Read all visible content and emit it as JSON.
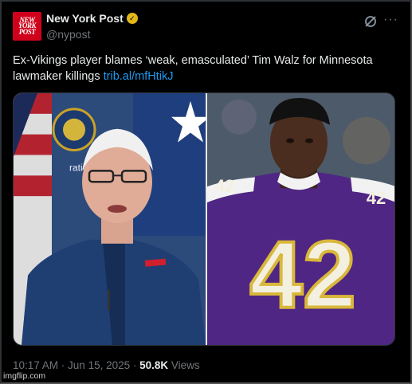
{
  "account": {
    "avatar_text": [
      "NEW",
      "YORK",
      "POST"
    ],
    "name": "New York Post",
    "handle": "@nypost",
    "verified_badge": "gold-check-badge"
  },
  "header_icons": {
    "grok": "grok-icon",
    "more": "more-icon",
    "more_glyph": "···"
  },
  "tweet": {
    "text": "Ex-Vikings player blames ‘weak, emasculated’ Tim Walz for Minnesota lawmaker killings ",
    "link": "trib.al/mfHtikJ"
  },
  "media": {
    "left_photo": {
      "sign_text": "ration"
    },
    "right_photo": {
      "jersey_number": "42"
    }
  },
  "meta": {
    "time": "10:17 AM",
    "separator1": " · ",
    "date": "Jun 15, 2025",
    "separator2": " · ",
    "views_count": "50.8K",
    "views_label": " Views"
  },
  "watermark": "imgflip.com",
  "colors": {
    "background": "#000000",
    "link": "#1d9bf0",
    "muted": "#71767b",
    "badge": "#e2b719",
    "avatar": "#d0021b",
    "vikings_purple": "#4f2683"
  }
}
